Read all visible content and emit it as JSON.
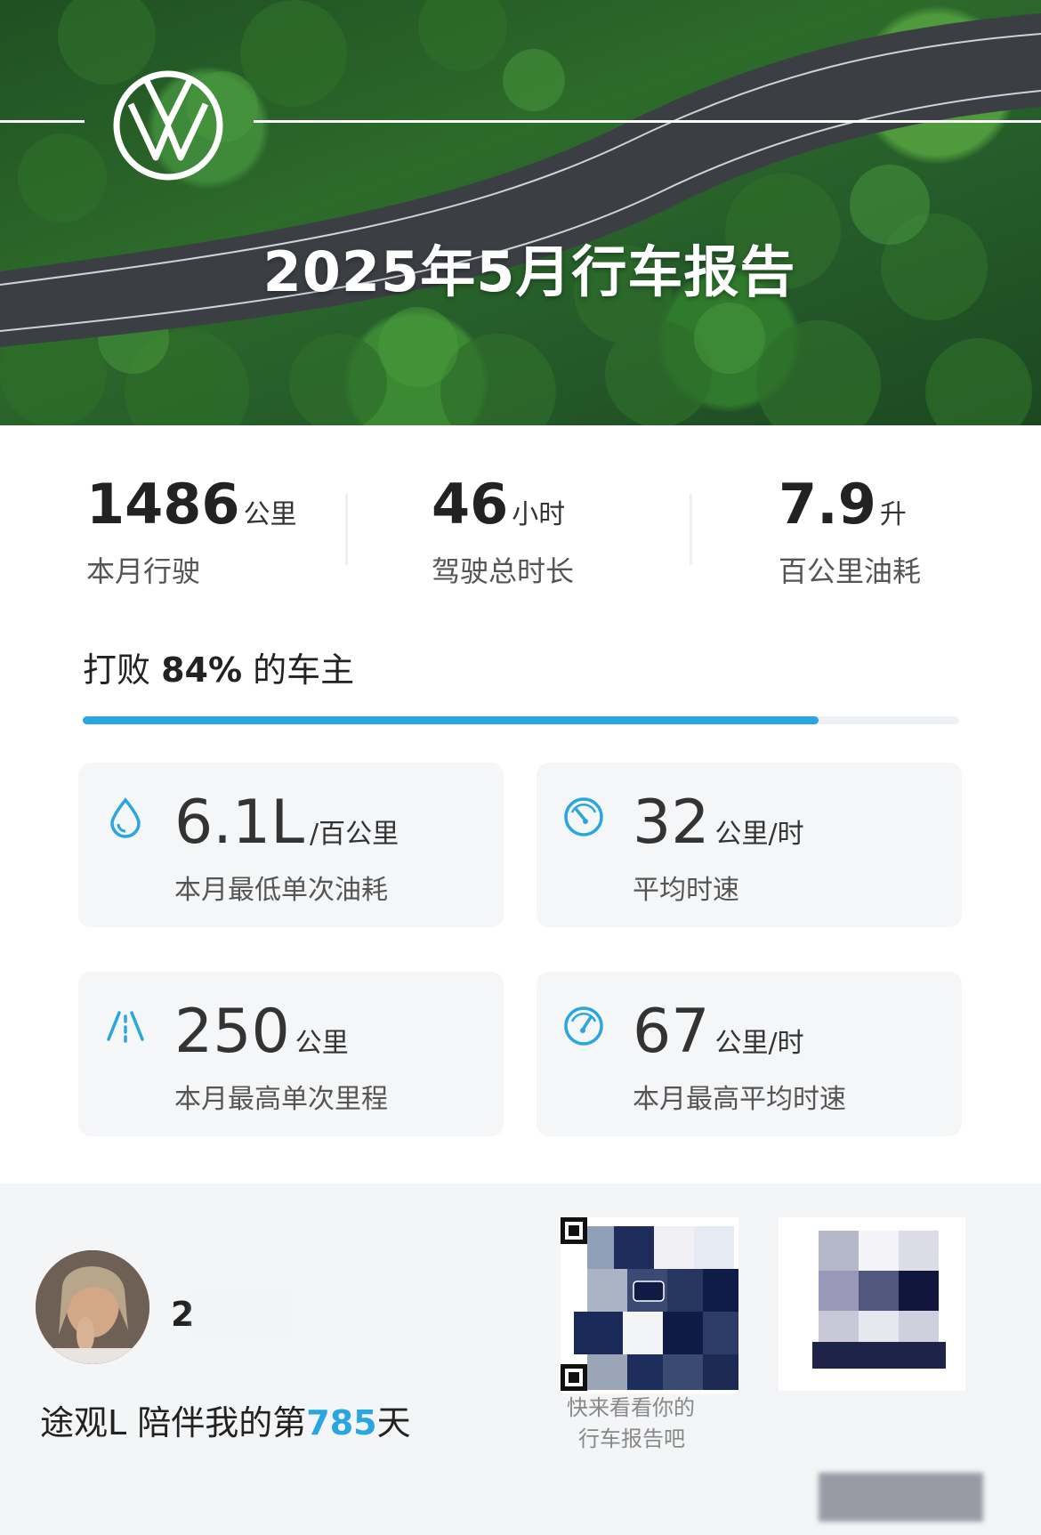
{
  "header": {
    "title": "2025年5月行车报告",
    "brand_logo": "vw-logo"
  },
  "stats": {
    "distance": {
      "value": "1486",
      "unit": "公里",
      "label": "本月行驶"
    },
    "duration": {
      "value": "46",
      "unit": "小时",
      "label": "驾驶总时长"
    },
    "fuel": {
      "value": "7.9",
      "unit": "升",
      "label": "百公里油耗"
    }
  },
  "ranking": {
    "prefix": "打败",
    "percent_text": "84%",
    "suffix": "的车主",
    "percent": 84
  },
  "tiles": {
    "min_fuel": {
      "icon": "droplet-icon",
      "value": "6.1L",
      "unit": "/百公里",
      "label": "本月最低单次油耗"
    },
    "avg_speed": {
      "icon": "speedometer-icon",
      "value": "32",
      "unit": "公里/时",
      "label": "平均时速"
    },
    "max_trip": {
      "icon": "road-icon",
      "value": "250",
      "unit": "公里",
      "label": "本月最高单次里程"
    },
    "max_avg_speed": {
      "icon": "speedometer-icon",
      "value": "67",
      "unit": "公里/时",
      "label": "本月最高平均时速"
    }
  },
  "footer": {
    "username": "2",
    "companion_prefix": "途观L 陪伴我的第",
    "companion_days": "785",
    "companion_suffix": "天",
    "qr_caption_line1": "快来看看你的",
    "qr_caption_line2": "行车报告吧"
  },
  "colors": {
    "accent": "#29a6df",
    "tile_bg": "#f4f6f8",
    "page_bg": "#f3f5f7"
  }
}
